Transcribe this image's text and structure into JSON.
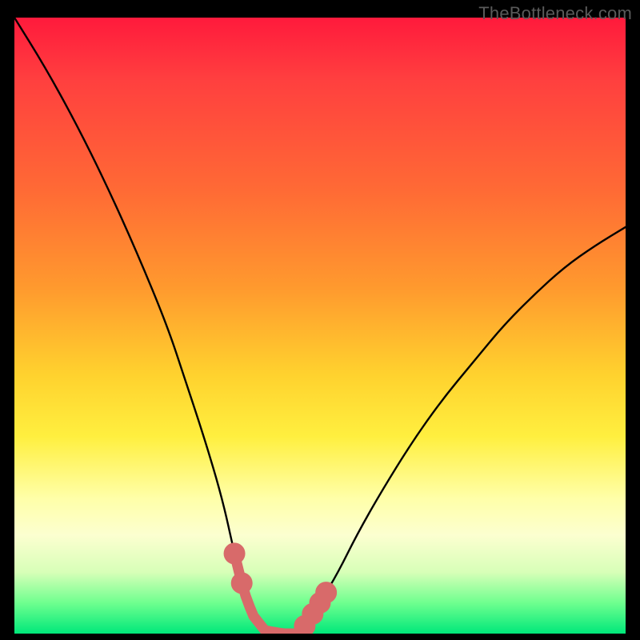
{
  "watermark": {
    "text": "TheBottleneck.com"
  },
  "chart_data": {
    "type": "line",
    "title": "",
    "xlabel": "",
    "ylabel": "",
    "xlim": [
      0,
      100
    ],
    "ylim": [
      0,
      100
    ],
    "grid": false,
    "legend_position": "none",
    "series": [
      {
        "name": "bottleneck-curve",
        "x": [
          0,
          5,
          10,
          15,
          20,
          25,
          28,
          31,
          34,
          36,
          37.5,
          39,
          41,
          44,
          46,
          47,
          48,
          50,
          53,
          56,
          60,
          65,
          70,
          75,
          80,
          85,
          90,
          95,
          100
        ],
        "values": [
          100,
          92,
          83,
          73,
          62,
          50,
          41,
          32,
          22,
          13,
          7,
          3,
          0.5,
          0,
          0,
          0.5,
          2,
          5,
          10,
          16,
          23,
          31,
          38,
          44,
          50,
          55,
          59.5,
          63,
          66
        ]
      },
      {
        "name": "highlight-band",
        "x_range": [
          36,
          51
        ],
        "y_range": [
          0,
          8
        ],
        "note": "salmon dots/line near curve minimum indicating optimal zone"
      }
    ],
    "colors": {
      "curve": "#000000",
      "highlight": "#d86a6a",
      "gradient_top": "#ff1a3c",
      "gradient_bottom": "#00e87a"
    }
  }
}
